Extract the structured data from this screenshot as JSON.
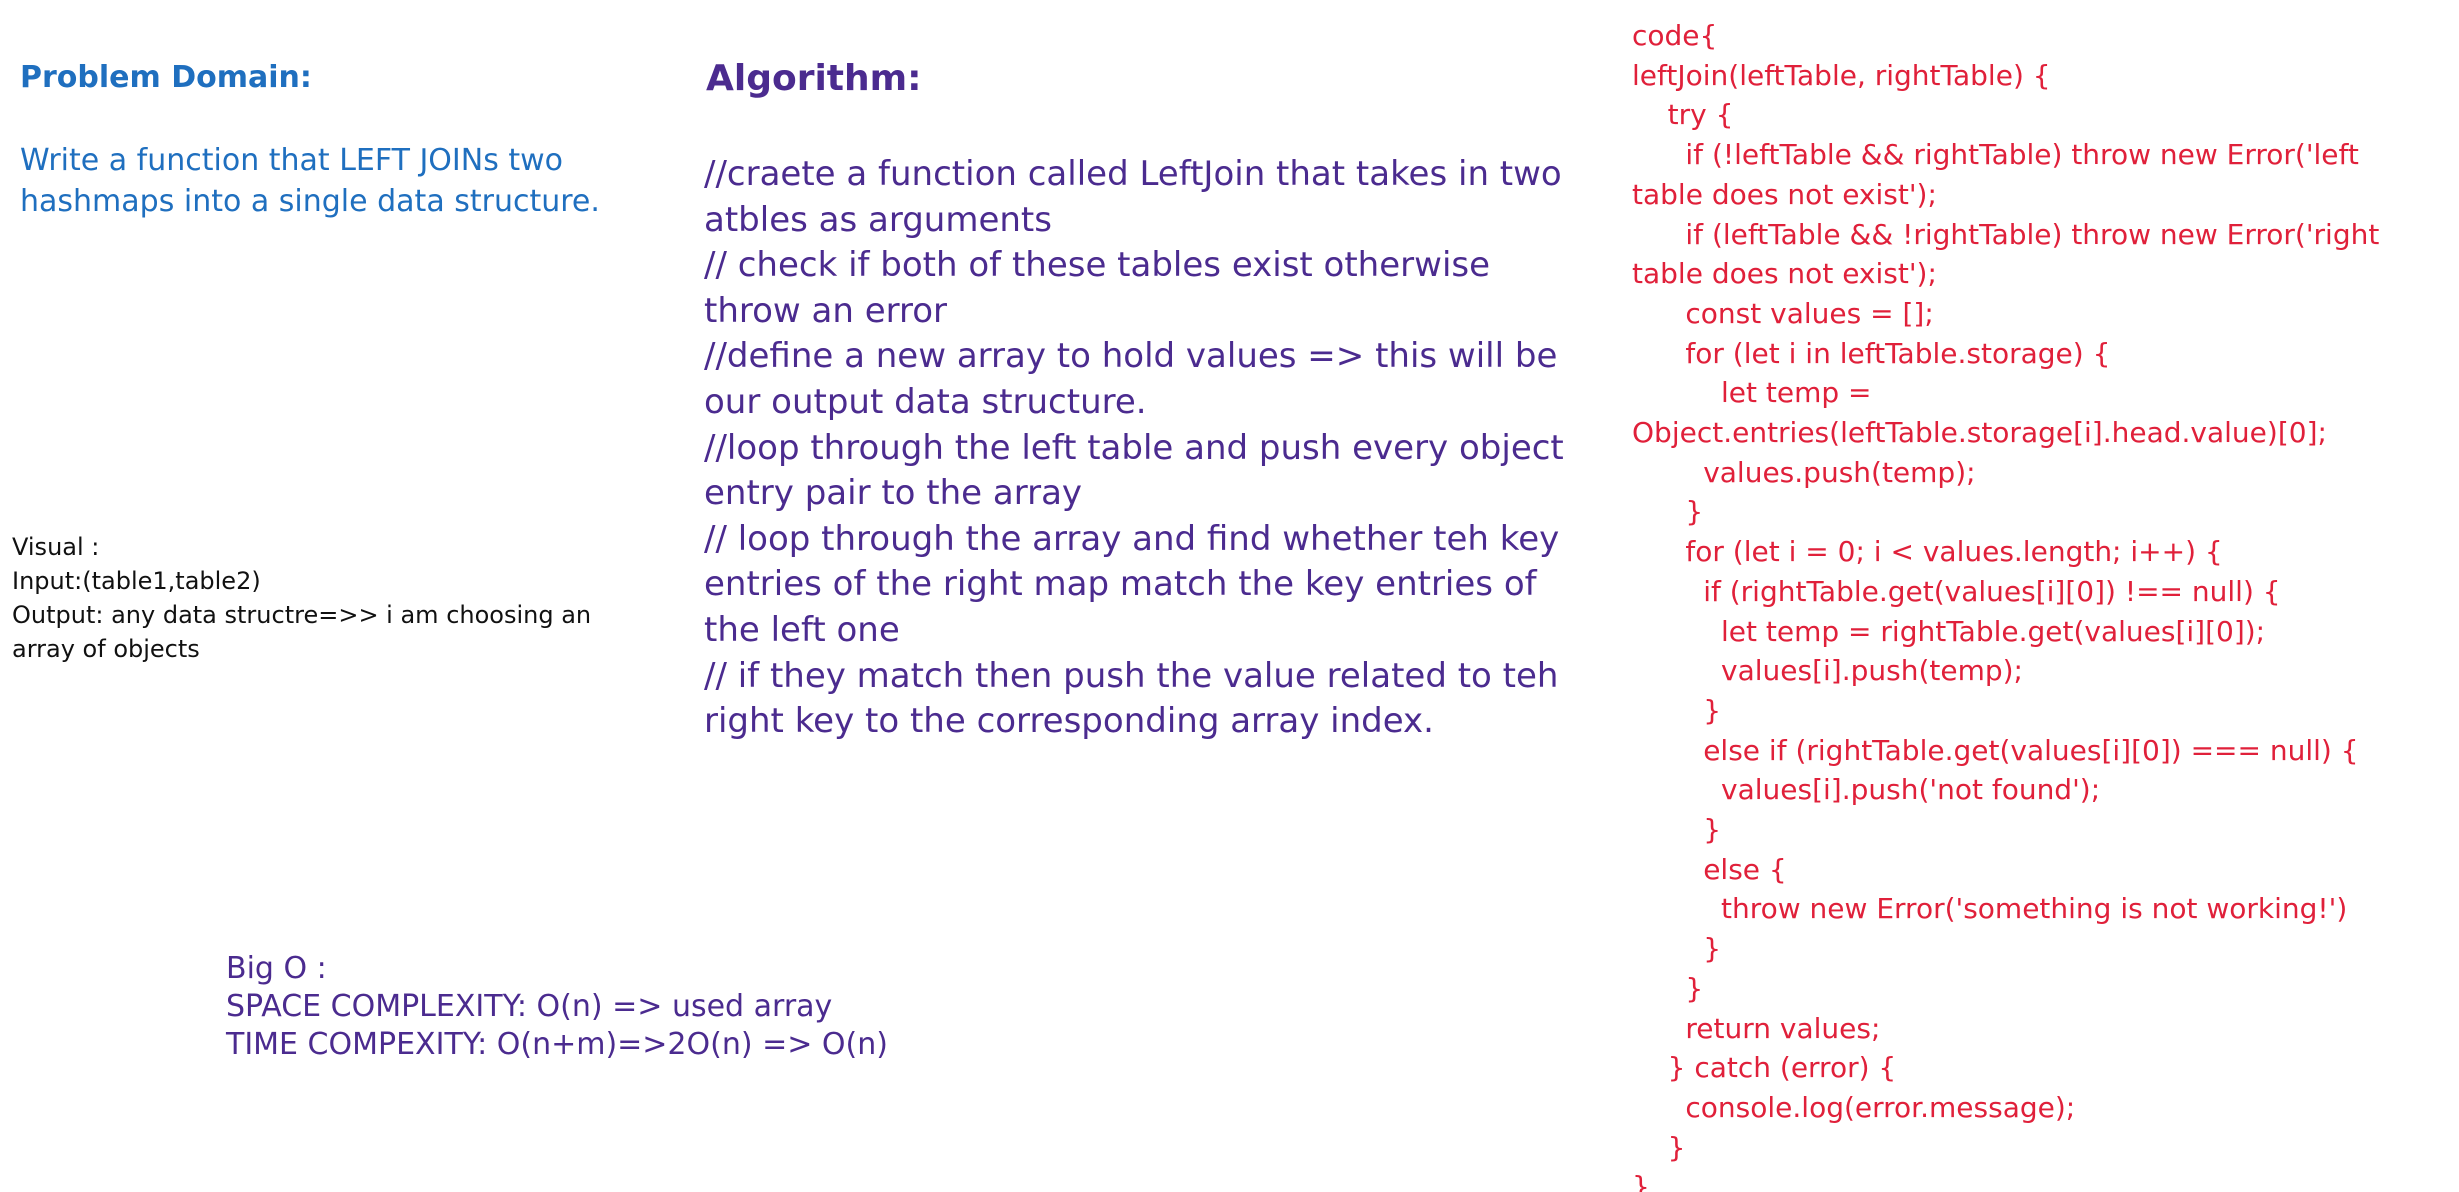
{
  "problem": {
    "title": "Problem Domain:",
    "description": "Write a function that LEFT JOINs two hashmaps into a single data structure."
  },
  "visual": {
    "label": "Visual :",
    "input": "Input:(table1,table2)",
    "output": "Output: any data structre=>> i am choosing an array of objects"
  },
  "algorithm": {
    "title": "Algorithm:",
    "steps": [
      "//craete a function called LeftJoin that takes in two atbles as arguments",
      "// check if both of these tables exist otherwise throw an error",
      "//define a new array to hold values => this will be our output data structure.",
      "//loop through the left table and push every object entry pair to the array",
      "// loop through the array and find whether teh key entries of the right map match the key entries of the left one",
      "// if they match then push the value related to teh right key to the corresponding array index."
    ]
  },
  "bigo": {
    "title": "Big O :",
    "space": "SPACE COMPLEXITY: O(n) => used array",
    "time": "TIME COMPEXITY: O(n+m)=>2O(n) => O(n)"
  },
  "code": {
    "lines": [
      "code{",
      "leftJoin(leftTable, rightTable) {",
      "    try {",
      "      if (!leftTable && rightTable) throw new Error('left",
      "table does not exist');",
      "      if (leftTable && !rightTable) throw new Error('right",
      "table does not exist');",
      "      const values = [];",
      "      for (let i in leftTable.storage) {",
      "          let temp =",
      "Object.entries(leftTable.storage[i].head.value)[0];",
      "        values.push(temp);",
      "      }",
      "      for (let i = 0; i < values.length; i++) {",
      "        if (rightTable.get(values[i][0]) !== null) {",
      "          let temp = rightTable.get(values[i][0]);",
      "          values[i].push(temp);",
      "        }",
      "        else if (rightTable.get(values[i][0]) === null) {",
      "          values[i].push('not found');",
      "        }",
      "        else {",
      "          throw new Error('something is not working!')",
      "        }",
      "      }",
      "      return values;",
      "    } catch (error) {",
      "      console.log(error.message);",
      "    }",
      "}"
    ]
  }
}
